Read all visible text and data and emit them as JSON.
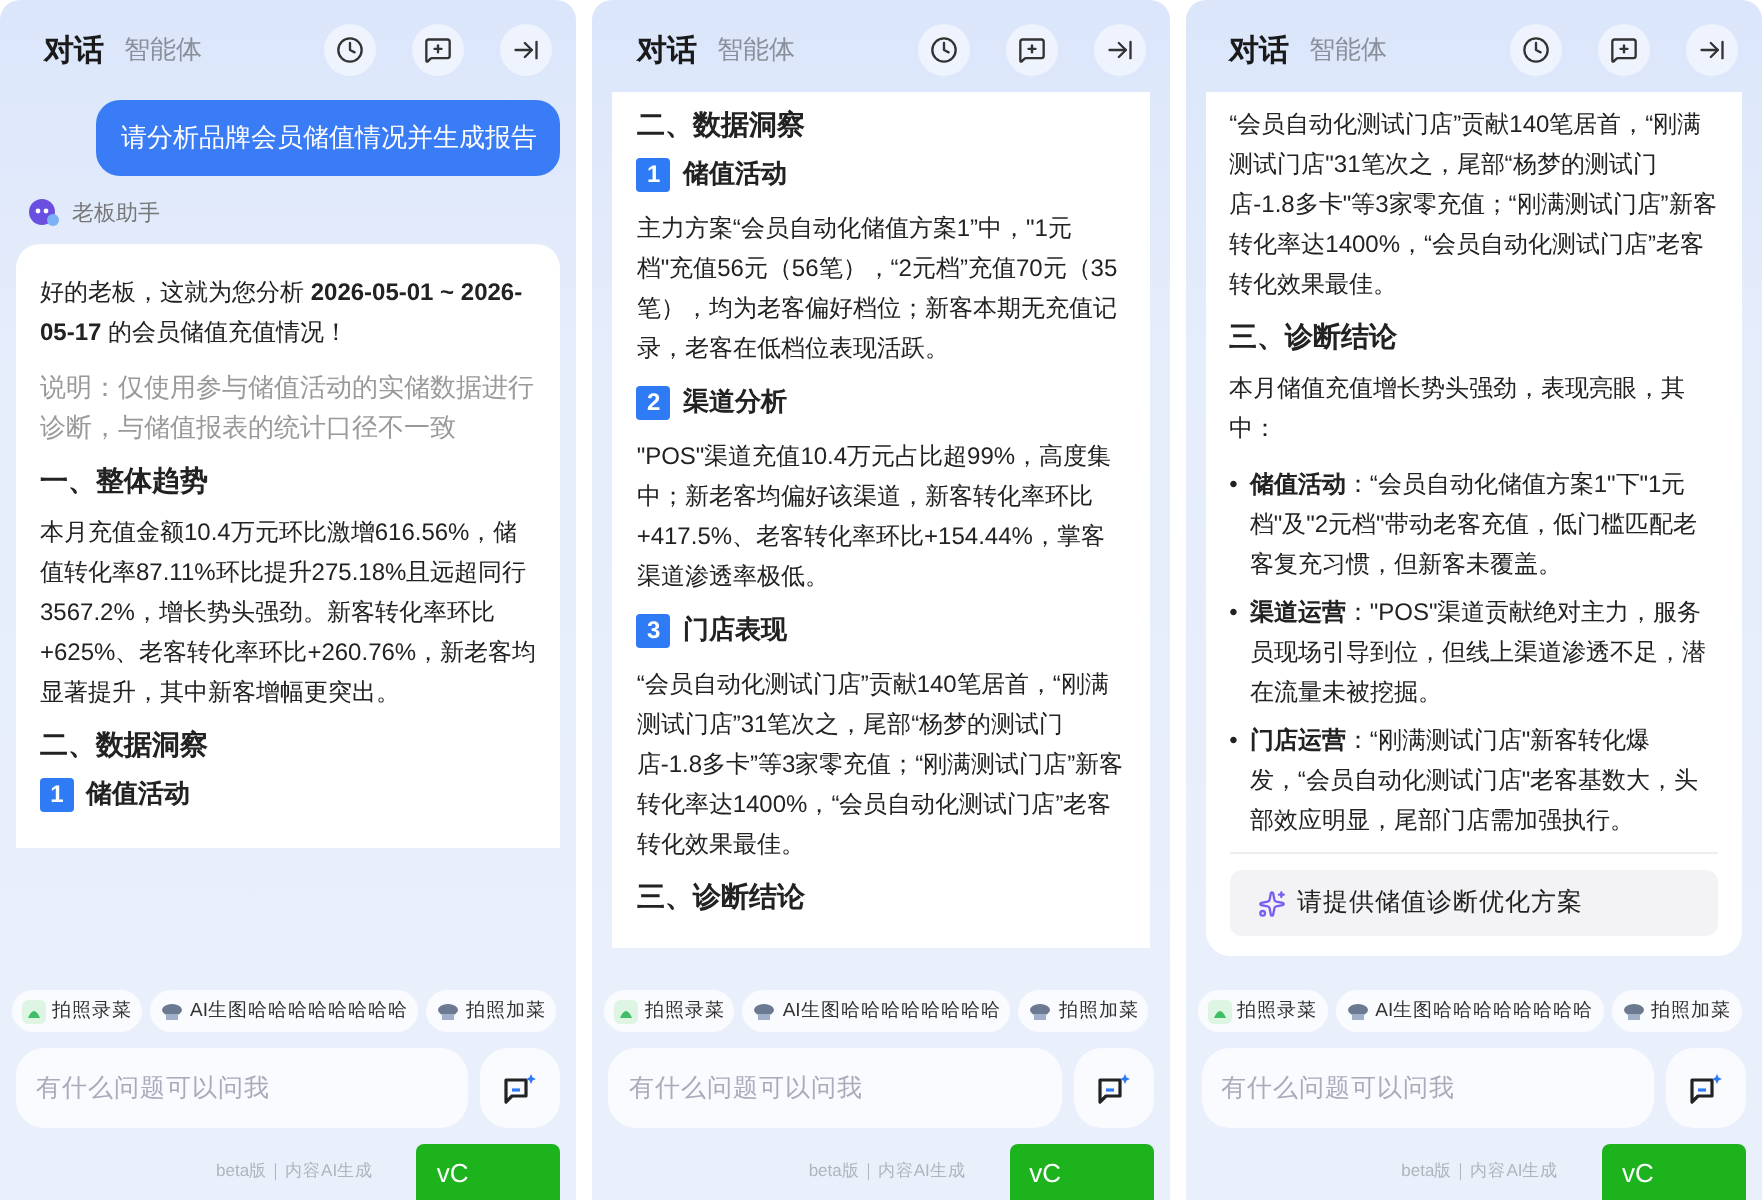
{
  "panels": [
    {
      "tabs": [
        {
          "label": "对话",
          "selected": true
        },
        {
          "label": "智能体",
          "selected": false
        }
      ],
      "messages": [
        {
          "kind": "user",
          "text": "请分析品牌会员储值情况并生成报告"
        },
        {
          "kind": "assistant",
          "name": "老板助手",
          "blocks": [
            {
              "kind": "paragraph",
              "text": "好的老板，这就为您分析 **2026-05-01 ~ 2026-05-17** 的会员储值充值情况！"
            },
            {
              "kind": "note",
              "text": "说明：仅使用参与储值活动的实储数据进行诊断，与储值报表的统计口径不一致"
            },
            {
              "kind": "heading",
              "text": "一、整体趋势"
            },
            {
              "kind": "paragraph",
              "text": "本月充值金额10.4万元环比激增616.56%，储值转化率87.11%环比提升275.18%且远超同行3567.2%，增长势头强劲。新客转化率环比+625%、老客转化率环比+260.76%，新老客均显著提升，其中新客增幅更突出。"
            },
            {
              "kind": "heading",
              "text": "二、数据洞察"
            },
            {
              "kind": "section",
              "number": "1",
              "text": "储值活动"
            }
          ]
        }
      ],
      "chips": [
        {
          "kind": "photo",
          "label": "拍照录菜"
        },
        {
          "kind": "hat",
          "label": "AI生图哈哈哈哈哈哈哈哈"
        },
        {
          "kind": "hat",
          "label": "拍照加菜"
        }
      ],
      "input": {
        "placeholder": "有什么问题可以问我"
      },
      "footer": "beta版｜内容AI生成",
      "badge": "vC"
    },
    {
      "tabs": [
        {
          "label": "对话",
          "selected": true
        },
        {
          "label": "智能体",
          "selected": false
        }
      ],
      "messages": [
        {
          "kind": "assistant_part",
          "blocks": [
            {
              "kind": "heading",
              "text": "二、数据洞察"
            },
            {
              "kind": "section",
              "number": "1",
              "text": "储值活动"
            },
            {
              "kind": "paragraph",
              "text": "主力方案“会员自动化储值方案1”中，\"1元档\"充值56元（56笔），“2元档”充值70元（35笔），均为老客偏好档位；新客本期无充值记录，老客在低档位表现活跃。"
            },
            {
              "kind": "section",
              "number": "2",
              "text": "渠道分析"
            },
            {
              "kind": "paragraph",
              "text": "\"POS\"渠道充值10.4万元占比超99%，高度集中；新老客均偏好该渠道，新客转化率环比+417.5%、老客转化率环比+154.44%，掌客渠道渗透率极低。"
            },
            {
              "kind": "section",
              "number": "3",
              "text": "门店表现"
            },
            {
              "kind": "paragraph",
              "text": "“会员自动化测试门店”贡献140笔居首，“刚满测试门店”31笔次之，尾部“杨梦的测试门店-1.8多卡”等3家零充值；“刚满测试门店”新客转化率达1400%，“会员自动化测试门店”老客转化效果最佳。"
            },
            {
              "kind": "heading",
              "text": "三、诊断结论"
            }
          ]
        }
      ],
      "chips": [
        {
          "kind": "photo",
          "label": "拍照录菜"
        },
        {
          "kind": "hat",
          "label": "AI生图哈哈哈哈哈哈哈哈"
        },
        {
          "kind": "hat",
          "label": "拍照加菜"
        }
      ],
      "input": {
        "placeholder": "有什么问题可以问我"
      },
      "footer": "beta版｜内容AI生成",
      "badge": "vC"
    },
    {
      "tabs": [
        {
          "label": "对话",
          "selected": true
        },
        {
          "label": "智能体",
          "selected": false
        }
      ],
      "messages": [
        {
          "kind": "assistant_part",
          "blocks": [
            {
              "kind": "paragraph",
              "text": "“会员自动化测试门店”贡献140笔居首，“刚满测试门店\"31笔次之，尾部“杨梦的测试门店-1.8多卡\"等3家零充值；“刚满测试门店”新客转化率达1400%，“会员自动化测试门店”老客转化效果最佳。"
            },
            {
              "kind": "heading",
              "text": "三、诊断结论"
            },
            {
              "kind": "paragraph",
              "text": "本月储值充值增长势头强劲，表现亮眼，其中："
            },
            {
              "kind": "bullets",
              "marker": "•",
              "items": [
                "**储值活动**：“会员自动化储值方案1\"下\"1元档\"及\"2元档\"带动老客充值，低门槛匹配老客复充习惯，但新客未覆盖。",
                "**渠道运营**：\"POS\"渠道贡献绝对主力，服务员现场引导到位，但线上渠道渗透不足，潜在流量未被挖掘。",
                "**门店运营**：“刚满测试门店\"新客转化爆发，“会员自动化测试门店\"老客基数大，头部效应明显，尾部门店需加强执行。"
              ]
            },
            {
              "kind": "suggestion",
              "text": "请提供储值诊断优化方案"
            }
          ]
        }
      ],
      "chips": [
        {
          "kind": "photo",
          "label": "拍照录菜"
        },
        {
          "kind": "hat",
          "label": "AI生图哈哈哈哈哈哈哈哈"
        },
        {
          "kind": "hat",
          "label": "拍照加菜"
        }
      ],
      "input": {
        "placeholder": "有什么问题可以问我"
      },
      "footer": "beta版｜内容AI生成",
      "badge": "vC"
    }
  ]
}
